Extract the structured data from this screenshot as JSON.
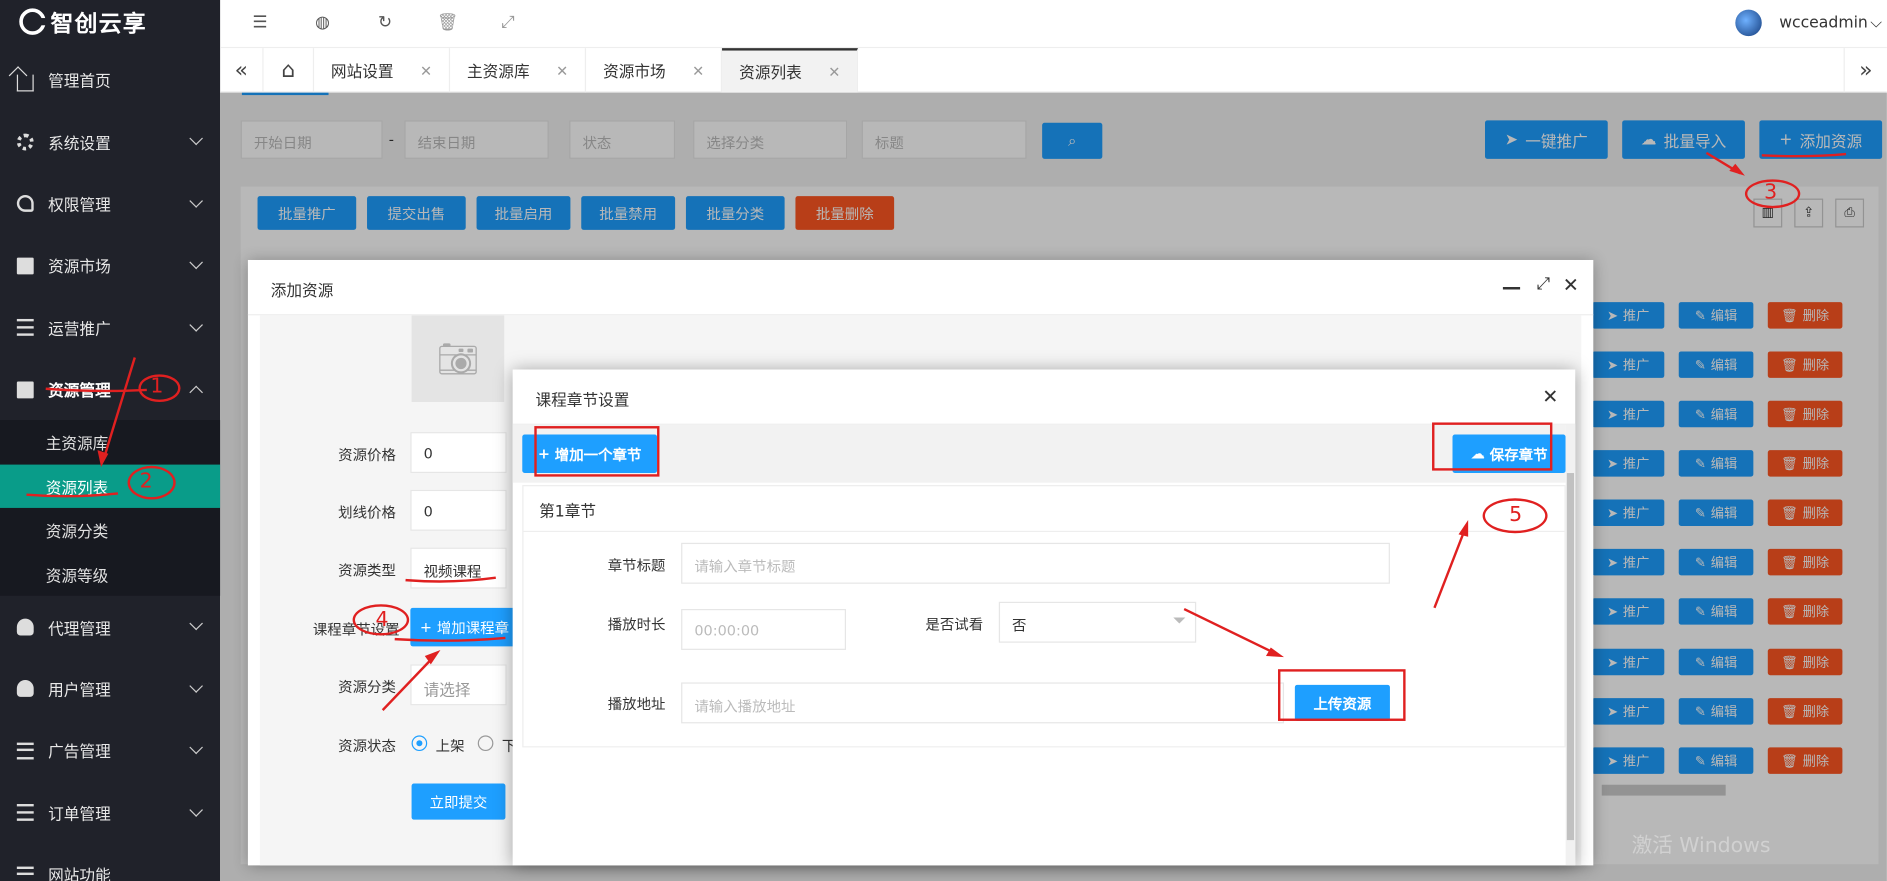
{
  "logo": {
    "text": "智创云享"
  },
  "sidebar": {
    "items": [
      {
        "label": "管理首页",
        "icon": "home-icon"
      },
      {
        "label": "系统设置",
        "icon": "gear-icon"
      },
      {
        "label": "权限管理",
        "icon": "key-icon"
      },
      {
        "label": "资源市场",
        "icon": "book-icon"
      },
      {
        "label": "运营推广",
        "icon": "list-icon"
      },
      {
        "label": "资源管理",
        "icon": "book-icon"
      },
      {
        "label": "代理管理",
        "icon": "user-icon"
      },
      {
        "label": "用户管理",
        "icon": "user-icon"
      },
      {
        "label": "广告管理",
        "icon": "list-icon"
      },
      {
        "label": "订单管理",
        "icon": "list-icon"
      },
      {
        "label": "网站功能",
        "icon": "list-icon"
      }
    ],
    "sub_items": [
      {
        "label": "主资源库"
      },
      {
        "label": "资源列表"
      },
      {
        "label": "资源分类"
      },
      {
        "label": "资源等级"
      }
    ]
  },
  "topbar": {
    "username": "wcceadmin"
  },
  "tabs": [
    {
      "label": "网站设置"
    },
    {
      "label": "主资源库"
    },
    {
      "label": "资源市场"
    },
    {
      "label": "资源列表"
    }
  ],
  "filters": {
    "start_date": "开始日期",
    "dash": "-",
    "end_date": "结束日期",
    "status": "状态",
    "category": "选择分类",
    "title": "标题"
  },
  "top_actions": {
    "promote": "一键推广",
    "import": "批量导入",
    "add": "添加资源"
  },
  "batch_actions": {
    "promote": "批量推广",
    "submit_sale": "提交出售",
    "enable": "批量启用",
    "disable": "批量禁用",
    "categorize": "批量分类",
    "delete": "批量删除"
  },
  "row_actions": {
    "promote": "推广",
    "edit": "编辑",
    "delete": "删除"
  },
  "dialog_add": {
    "title": "添加资源",
    "price_label": "资源价格",
    "price_value": "0",
    "strike_label": "划线价格",
    "strike_value": "0",
    "type_label": "资源类型",
    "type_value": "视频课程",
    "chapter_label": "课程章节设置",
    "chapter_button": "增加课程章",
    "category_label": "资源分类",
    "category_placeholder": "请选择",
    "status_label": "资源状态",
    "status_on": "上架",
    "status_off": "下",
    "submit": "立即提交"
  },
  "dialog_chapter": {
    "title": "课程章节设置",
    "add_chapter": "增加一个章节",
    "save_chapter": "保存章节",
    "chapter_name": "第1章节",
    "title_label": "章节标题",
    "title_placeholder": "请输入章节标题",
    "duration_label": "播放时长",
    "duration_placeholder": "00:00:00",
    "trial_label": "是否试看",
    "trial_value": "否",
    "url_label": "播放地址",
    "url_placeholder": "请输入播放地址",
    "upload": "上传资源"
  },
  "annotations": {
    "n1": "1",
    "n2": "2",
    "n3": "3",
    "n4": "4",
    "n5": "5"
  },
  "watermark": "激活 Windows",
  "colors": {
    "accent": "#1e9fff",
    "danger": "#ff5722",
    "sidebar": "#20222a",
    "active_sub": "#099c89",
    "annotation": "#e02020"
  }
}
